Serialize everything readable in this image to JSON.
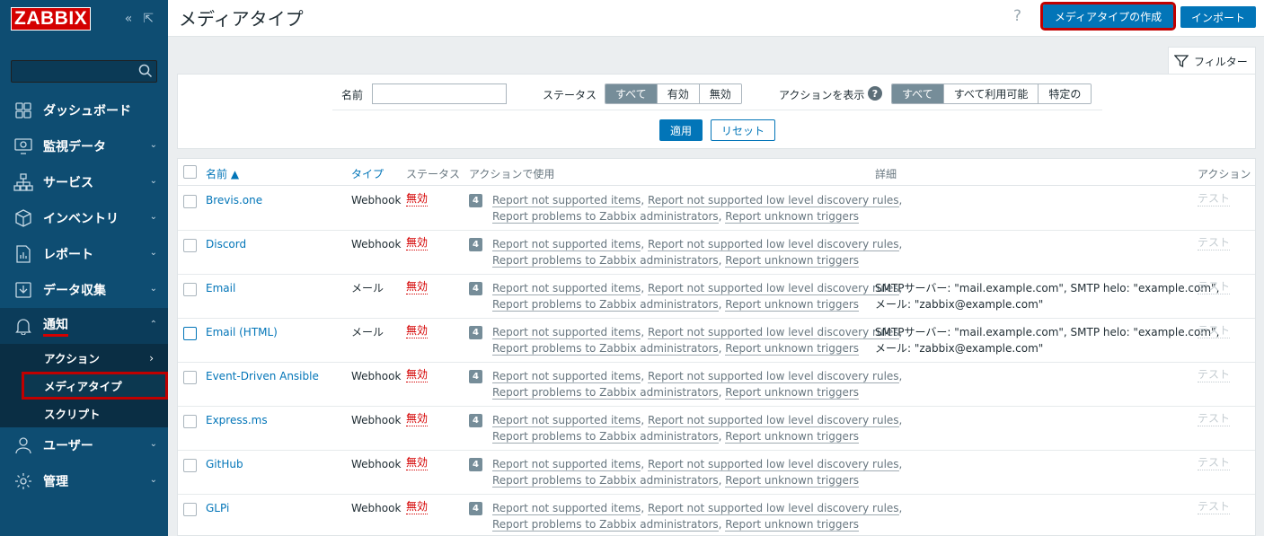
{
  "app": {
    "logo": "ZABBIX",
    "collapse_icon": "«",
    "expand_icon": "⇱"
  },
  "sidebar": {
    "items": [
      {
        "label": "ダッシュボード",
        "icon": "dashboard-icon"
      },
      {
        "label": "監視データ",
        "icon": "monitoring-icon"
      },
      {
        "label": "サービス",
        "icon": "services-icon"
      },
      {
        "label": "インベントリ",
        "icon": "inventory-icon"
      },
      {
        "label": "レポート",
        "icon": "reports-icon"
      },
      {
        "label": "データ収集",
        "icon": "data-collection-icon"
      },
      {
        "label": "通知",
        "icon": "bell-icon"
      },
      {
        "label": "ユーザー",
        "icon": "users-icon"
      },
      {
        "label": "管理",
        "icon": "gear-icon"
      }
    ],
    "sub_items": [
      {
        "label": "アクション"
      },
      {
        "label": "メディアタイプ"
      },
      {
        "label": "スクリプト"
      }
    ]
  },
  "header": {
    "title": "メディアタイプ",
    "help": "?",
    "create_label": "メディアタイプの作成",
    "import_label": "インポート"
  },
  "filter": {
    "tab_label": "フィルター",
    "name_label": "名前",
    "name_value": "",
    "status_label": "ステータス",
    "status_options": [
      "すべて",
      "有効",
      "無効"
    ],
    "actions_label": "アクションを表示",
    "actions_help": "?",
    "actions_options": [
      "すべて",
      "すべて利用可能",
      "特定の"
    ],
    "apply_label": "適用",
    "reset_label": "リセット"
  },
  "table": {
    "headers": {
      "name": "名前 ▲",
      "type": "タイプ",
      "status": "ステータス",
      "used_in": "アクションで使用",
      "details": "詳細",
      "action": "アクション"
    },
    "rows": [
      {
        "name": "Brevis.one",
        "type": "Webhook",
        "status": "無効",
        "count": "4",
        "a1": "Report not supported items",
        "a2": "Report not supported low level discovery rules",
        "a3": "Report problems to Zabbix administrators",
        "a4": "Report unknown triggers",
        "d1": "",
        "d2": "",
        "test": "テスト"
      },
      {
        "name": "Discord",
        "type": "Webhook",
        "status": "無効",
        "count": "4",
        "a1": "Report not supported items",
        "a2": "Report not supported low level discovery rules",
        "a3": "Report problems to Zabbix administrators",
        "a4": "Report unknown triggers",
        "d1": "",
        "d2": "",
        "test": "テスト"
      },
      {
        "name": "Email",
        "type": "メール",
        "status": "無効",
        "count": "4",
        "a1": "Report not supported items",
        "a2": "Report not supported low level discovery rules",
        "a3": "Report problems to Zabbix administrators",
        "a4": "Report unknown triggers",
        "d1": "SMTPサーバー: \"mail.example.com\", SMTP helo: \"example.com\",",
        "d2": "メール: \"zabbix@example.com\"",
        "test": "テスト"
      },
      {
        "name": "Email (HTML)",
        "type": "メール",
        "status": "無効",
        "count": "4",
        "a1": "Report not supported items",
        "a2": "Report not supported low level discovery rules",
        "a3": "Report problems to Zabbix administrators",
        "a4": "Report unknown triggers",
        "d1": "SMTPサーバー: \"mail.example.com\", SMTP helo: \"example.com\",",
        "d2": "メール: \"zabbix@example.com\"",
        "test": "テスト"
      },
      {
        "name": "Event-Driven Ansible",
        "type": "Webhook",
        "status": "無効",
        "count": "4",
        "a1": "Report not supported items",
        "a2": "Report not supported low level discovery rules",
        "a3": "Report problems to Zabbix administrators",
        "a4": "Report unknown triggers",
        "d1": "",
        "d2": "",
        "test": "テスト"
      },
      {
        "name": "Express.ms",
        "type": "Webhook",
        "status": "無効",
        "count": "4",
        "a1": "Report not supported items",
        "a2": "Report not supported low level discovery rules",
        "a3": "Report problems to Zabbix administrators",
        "a4": "Report unknown triggers",
        "d1": "",
        "d2": "",
        "test": "テスト"
      },
      {
        "name": "GitHub",
        "type": "Webhook",
        "status": "無効",
        "count": "4",
        "a1": "Report not supported items",
        "a2": "Report not supported low level discovery rules",
        "a3": "Report problems to Zabbix administrators",
        "a4": "Report unknown triggers",
        "d1": "",
        "d2": "",
        "test": "テスト"
      },
      {
        "name": "GLPi",
        "type": "Webhook",
        "status": "無効",
        "count": "4",
        "a1": "Report not supported items",
        "a2": "Report not supported low level discovery rules",
        "a3": "Report problems to Zabbix administrators",
        "a4": "Report unknown triggers",
        "d1": "",
        "d2": "",
        "test": "テスト"
      }
    ]
  },
  "colors": {
    "sidebar": "#0e4d72",
    "accent": "#0275b8",
    "disabled": "#d40000",
    "highlight": "#c00000"
  }
}
